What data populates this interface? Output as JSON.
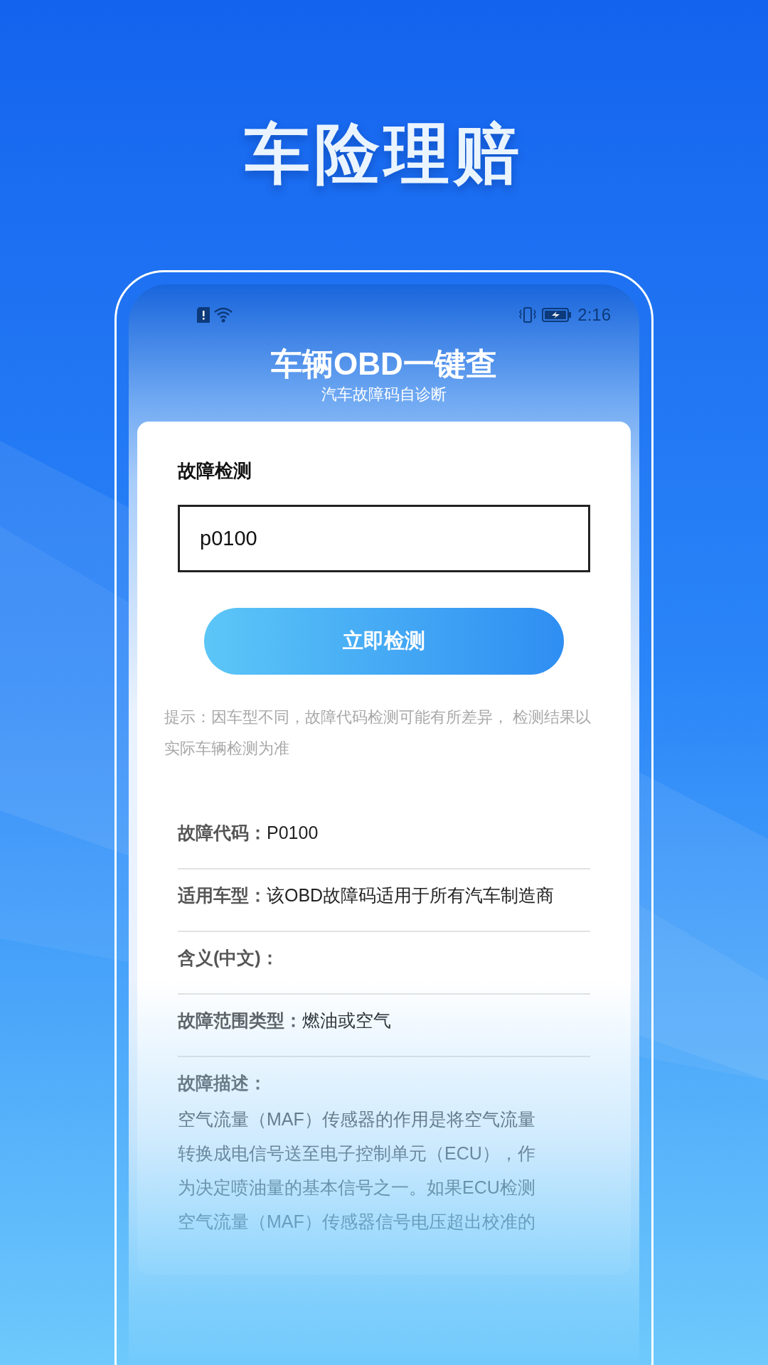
{
  "headline": "车险理赔",
  "status_bar": {
    "time": "2:16"
  },
  "app": {
    "title": "车辆OBD一键查",
    "subtitle": "汽车故障码自诊断"
  },
  "detect": {
    "label": "故障检测",
    "value": "p0100",
    "button": "立即检测",
    "hint": "提示：因车型不同，故障代码检测可能有所差异， 检测结果以实际车辆检测为准"
  },
  "results": [
    {
      "label": "故障代码：",
      "value": "P0100"
    },
    {
      "label": "适用车型：",
      "value": "该OBD故障码适用于所有汽车制造商"
    },
    {
      "label": "含义(中文)："
    },
    {
      "label": "故障范围类型：",
      "value": "燃油或空气"
    }
  ],
  "description": {
    "label": "故障描述：",
    "lines": [
      "空气流量（MAF）传感器的作用是将空气流量",
      "转换成电信号送至电子控制单元（ECU），作",
      "为决定喷油量的基本信号之一。如果ECU检测",
      "空气流量（MAF）传感器信号电压超出校准的"
    ]
  }
}
